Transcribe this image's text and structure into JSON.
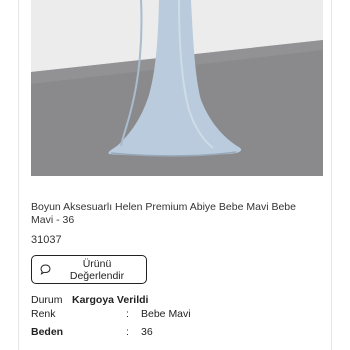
{
  "product": {
    "image_alt": "Light blue satin gown",
    "name": "Boyun Aksesuarlı Helen Premium Abiye Bebe Mavi Bebe Mavi - 36",
    "code": "31037",
    "review_button_label": "Ürünü Değerlendir",
    "status_label": "Durum",
    "status_value": "Kargoya Verildi",
    "details": [
      {
        "label": "Renk",
        "colon": ":",
        "value": "Bebe Mavi"
      },
      {
        "label": "Beden",
        "colon": ":",
        "value": "36"
      }
    ]
  },
  "icons": {
    "review": "chat-bubble-icon"
  },
  "colors": {
    "dress": "#b9cbdc",
    "floor": "#8b8b8d",
    "wall": "#e9e9e9",
    "border": "#222222"
  }
}
